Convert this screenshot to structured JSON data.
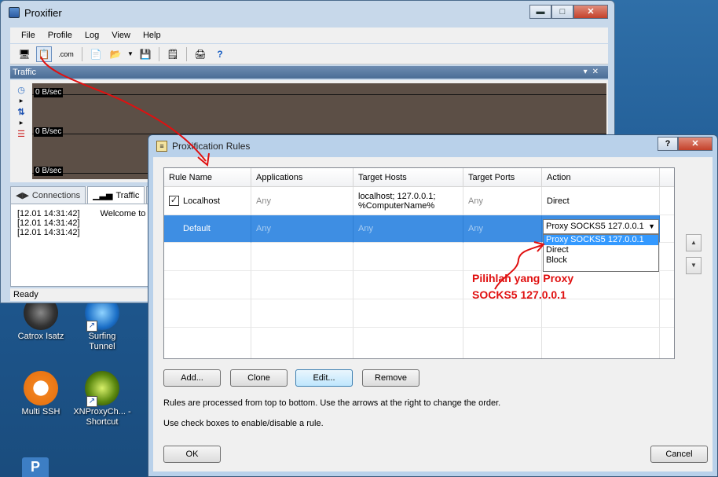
{
  "main_window": {
    "title": "Proxifier",
    "menu": [
      "File",
      "Profile",
      "Log",
      "View",
      "Help"
    ],
    "toolbar_com_label": ".com",
    "traffic_header": "Traffic",
    "graph_labels": [
      "0 B/sec",
      "0 B/sec",
      "0 B/sec"
    ],
    "tabs": [
      "Connections",
      "Traffic"
    ],
    "log": [
      {
        "time": "[12.01 14:31:42]",
        "msg": "Welcome to Pro"
      },
      {
        "time": "[12.01 14:31:42]",
        "msg": ""
      },
      {
        "time": "[12.01 14:31:42]",
        "msg": ""
      }
    ],
    "status": "Ready"
  },
  "desktop": {
    "icons": [
      {
        "label": "Catrox Isatz"
      },
      {
        "label": "Surfing Tunnel"
      },
      {
        "label": "Multi SSH"
      },
      {
        "label": "XNProxyCh... - Shortcut"
      }
    ]
  },
  "dialog": {
    "title": "Proxification Rules",
    "columns": [
      "Rule Name",
      "Applications",
      "Target Hosts",
      "Target Ports",
      "Action"
    ],
    "rules": [
      {
        "name": "Localhost",
        "applications": "Any",
        "target_hosts_line1": "localhost; 127.0.0.1;",
        "target_hosts_line2": "%ComputerName%",
        "target_ports": "Any",
        "action": "Direct",
        "checked": true
      },
      {
        "name": "Default",
        "applications": "Any",
        "target_hosts_line1": "Any",
        "target_ports": "Any",
        "action": "Proxy SOCKS5 127.0.0.1"
      }
    ],
    "action_options": [
      "Proxy SOCKS5 127.0.0.1",
      "Direct",
      "Block"
    ],
    "note_line1": "Pilihlah yang Proxy",
    "note_line2": "SOCKS5 127.0.0.1",
    "buttons": {
      "add": "Add...",
      "clone": "Clone",
      "edit": "Edit...",
      "remove": "Remove",
      "ok": "OK",
      "cancel": "Cancel"
    },
    "info1": "Rules are processed from top to bottom. Use the arrows at the right to change the order.",
    "info2": "Use check boxes to enable/disable a rule."
  },
  "colors": {
    "selection": "#3e8ee3",
    "annotation": "#e01010",
    "dropdown_highlight": "#3399ff"
  }
}
